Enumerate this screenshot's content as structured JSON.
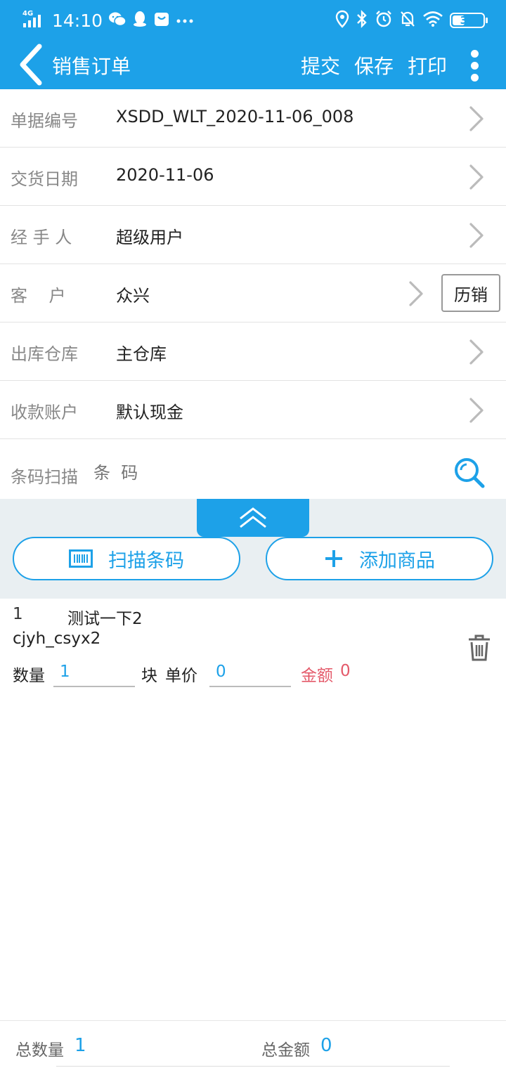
{
  "status_bar": {
    "network": "4G",
    "time": "14:10",
    "battery": "38"
  },
  "app_bar": {
    "title": "销售订单",
    "actions": [
      "提交",
      "保存",
      "打印"
    ]
  },
  "form": {
    "rows": [
      {
        "label": "单据编号",
        "value": "XSDD_WLT_2020-11-06_008"
      },
      {
        "label": "交货日期",
        "value": "2020-11-06"
      },
      {
        "label": "经 手 人",
        "value": "超级用户"
      },
      {
        "label": "客    户",
        "value": "众兴"
      },
      {
        "label": "出库仓库",
        "value": "主仓库"
      },
      {
        "label": "收款账户",
        "value": "默认现金"
      }
    ],
    "history_button": "历销"
  },
  "barcode": {
    "label": "条码扫描",
    "placeholder": "条  码"
  },
  "panel": {
    "scan_label": "扫描条码",
    "add_label": "添加商品"
  },
  "items": [
    {
      "index": "1",
      "name": "测试一下2",
      "code": "cjyh_csyx2",
      "qty_label": "数量",
      "qty": "1",
      "unit": "块",
      "price_label": "单价",
      "price": "0",
      "amount_label": "金额",
      "amount": "0"
    }
  ],
  "footer": {
    "total_qty_label": "总数量",
    "total_qty": "1",
    "total_amount_label": "总金额",
    "total_amount": "0"
  },
  "colors": {
    "primary": "#1da1e8",
    "amount": "#e45a6a"
  }
}
